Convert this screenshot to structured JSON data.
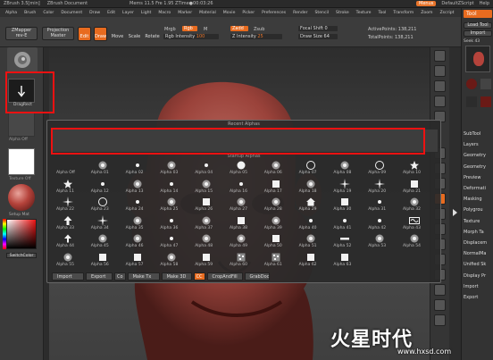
{
  "titlebar": {
    "app": "ZBrush 3.5[min]",
    "document": "ZBrush Document",
    "stats": "Mems 11.5  Fre 1.95  ZTime●00:03:26",
    "menus_label": "Menus",
    "script_label": "DefaultZScript",
    "help_label": "Help"
  },
  "menubar": {
    "items": [
      "Alpha",
      "Brush",
      "Color",
      "Document",
      "Draw",
      "Edit",
      "Layer",
      "Light",
      "Macro",
      "Marker",
      "Material",
      "Movie",
      "Picker",
      "Preferences",
      "Render",
      "Stencil",
      "Stroke",
      "Texture",
      "Tool",
      "Transform",
      "Zoom",
      "Zscript",
      "Zplugin"
    ]
  },
  "toolbar": {
    "zmapper": "ZMapper",
    "zmapper_sub": "rev-E",
    "projection_master": "Projection",
    "projection_master_sub": "Master",
    "edit": "Edit",
    "draw": "Draw",
    "move": "Move",
    "scale": "Scale",
    "rotate": "Rotate",
    "mrgb": "Mrgb",
    "rgb": "Rgb",
    "m": "M",
    "rgb_intensity_label": "Rgb Intensity",
    "rgb_intensity_value": "100",
    "zadd": "Zadd",
    "zsub": "Zsub",
    "z_intensity_label": "Z Intensity",
    "z_intensity_value": "25",
    "focal_shift_label": "Focal Shift",
    "focal_shift_value": "0",
    "draw_size_label": "Draw Size",
    "draw_size_value": "64",
    "active_points": "ActivePoints: 138,211",
    "total_points": "TotalPoints: 138,211"
  },
  "leftshelf": {
    "dragrect": "DragRect",
    "brush_label": "Alpha Off",
    "texture_label": "Texture Off",
    "material_label": "Setup Mat",
    "switch_color": "SwitchColor"
  },
  "popup": {
    "recent_label": "Recent Alphas",
    "startic_label": "Startup Alphas",
    "alphas": [
      {
        "name": "Alpha Off",
        "shape": "none"
      },
      {
        "name": "Alpha 01",
        "shape": "soft"
      },
      {
        "name": "Alpha 02",
        "shape": "dot"
      },
      {
        "name": "Alpha 03",
        "shape": "soft"
      },
      {
        "name": "Alpha 04",
        "shape": "dot"
      },
      {
        "name": "Alpha 05",
        "shape": "bigdot"
      },
      {
        "name": "Alpha 06",
        "shape": "soft"
      },
      {
        "name": "Alpha 07",
        "shape": "ring"
      },
      {
        "name": "Alpha 08",
        "shape": "soft"
      },
      {
        "name": "Alpha 09",
        "shape": "ring"
      },
      {
        "name": "Alpha 10",
        "shape": "star"
      },
      {
        "name": "Alpha 11",
        "shape": "star"
      },
      {
        "name": "Alpha 12",
        "shape": "dot"
      },
      {
        "name": "Alpha 13",
        "shape": "soft"
      },
      {
        "name": "Alpha 14",
        "shape": "dot"
      },
      {
        "name": "Alpha 15",
        "shape": "soft"
      },
      {
        "name": "Alpha 16",
        "shape": "dot"
      },
      {
        "name": "Alpha 17",
        "shape": "square"
      },
      {
        "name": "Alpha 18",
        "shape": "soft"
      },
      {
        "name": "Alpha 19",
        "shape": "spark"
      },
      {
        "name": "Alpha 20",
        "shape": "spark"
      },
      {
        "name": "Alpha 21",
        "shape": "square"
      },
      {
        "name": "Alpha 22",
        "shape": "spark"
      },
      {
        "name": "Alpha 23",
        "shape": "ring"
      },
      {
        "name": "Alpha 24",
        "shape": "dot"
      },
      {
        "name": "Alpha 25",
        "shape": "soft"
      },
      {
        "name": "Alpha 26",
        "shape": "square"
      },
      {
        "name": "Alpha 27",
        "shape": "soft"
      },
      {
        "name": "Alpha 28",
        "shape": "soft"
      },
      {
        "name": "Alpha 29",
        "shape": "house"
      },
      {
        "name": "Alpha 30",
        "shape": "square"
      },
      {
        "name": "Alpha 31",
        "shape": "dot"
      },
      {
        "name": "Alpha 32",
        "shape": "soft"
      },
      {
        "name": "Alpha 33",
        "shape": "arrow"
      },
      {
        "name": "Alpha 34",
        "shape": "spark"
      },
      {
        "name": "Alpha 35",
        "shape": "soft"
      },
      {
        "name": "Alpha 36",
        "shape": "dot"
      },
      {
        "name": "Alpha 37",
        "shape": "soft"
      },
      {
        "name": "Alpha 38",
        "shape": "square"
      },
      {
        "name": "Alpha 39",
        "shape": "soft"
      },
      {
        "name": "Alpha 40",
        "shape": "dot"
      },
      {
        "name": "Alpha 41",
        "shape": "dot"
      },
      {
        "name": "Alpha 42",
        "shape": "dot"
      },
      {
        "name": "Alpha 43",
        "shape": "pattern"
      },
      {
        "name": "Alpha 44",
        "shape": "arrowup"
      },
      {
        "name": "Alpha 45",
        "shape": "soft"
      },
      {
        "name": "Alpha 46",
        "shape": "soft"
      },
      {
        "name": "Alpha 47",
        "shape": "dot"
      },
      {
        "name": "Alpha 48",
        "shape": "soft"
      },
      {
        "name": "Alpha 49",
        "shape": "soft"
      },
      {
        "name": "Alpha 50",
        "shape": "square"
      },
      {
        "name": "Alpha 51",
        "shape": "soft"
      },
      {
        "name": "Alpha 52",
        "shape": "bar"
      },
      {
        "name": "Alpha 53",
        "shape": "soft"
      },
      {
        "name": "Alpha 54",
        "shape": "soft"
      },
      {
        "name": "Alpha 55",
        "shape": "soft"
      },
      {
        "name": "Alpha 56",
        "shape": "square"
      },
      {
        "name": "Alpha 57",
        "shape": "square"
      },
      {
        "name": "Alpha 58",
        "shape": "soft"
      },
      {
        "name": "Alpha 59",
        "shape": "square"
      },
      {
        "name": "Alpha 60",
        "shape": "noise"
      },
      {
        "name": "Alpha 61",
        "shape": "noise"
      },
      {
        "name": "Alpha 62",
        "shape": "square"
      },
      {
        "name": "Alpha 63",
        "shape": "square"
      }
    ],
    "import": "Import",
    "export": "Export",
    "co_badge": "Co",
    "make_tx": "Make Tx",
    "make_3d": "Make 3D",
    "cc_badge": "CC",
    "crop_and_fill": "CropAndFill",
    "grab_doc": "GrabDoc"
  },
  "rightpanel": {
    "tool_label": "Tool",
    "load_tool": "Load Tool",
    "import": "Import",
    "seek_label": "Seek",
    "seek_value": "43",
    "items": [
      "SubTool",
      "Layers",
      "Geometry",
      "Geometry",
      "Preview",
      "Deformati",
      "Masking",
      "Polygrou",
      "Texture",
      "Morph Ta",
      "Displacem",
      "NormalMa",
      "Unified Sk",
      "Display Pr",
      "Import",
      "Export"
    ]
  },
  "watermark": {
    "brand": "火星时代",
    "url": "www.hxsd.com"
  },
  "colors": {
    "accent": "#e86b1f",
    "highlight_box": "#e11111",
    "model_red": "#b5433b"
  }
}
